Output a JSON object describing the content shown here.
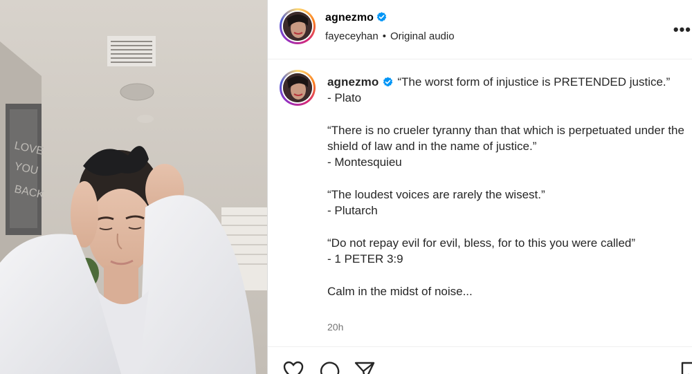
{
  "post": {
    "username": "agnezmo",
    "audio_user": "fayeceyhan",
    "audio_label": "Original audio",
    "more_label": "•••"
  },
  "media": {
    "wall_sign_text": [
      "LOVE",
      "YOU",
      "BACK"
    ]
  },
  "caption": {
    "username": "agnezmo",
    "lines": [
      "“The worst form of injustice is PRETENDED justice.”",
      "- Plato",
      "",
      "“There is no crueler tyranny than that which is perpetuated under the shield of law and in the name of justice.”",
      "- Montesquieu",
      "",
      "“The loudest voices are rarely the wisest.”",
      "- Plutarch",
      "",
      "“Do not repay evil for evil, bless, for to this you were called”",
      "- 1 PETER 3:9",
      "",
      "Calm in the midst of noise..."
    ],
    "time": "20h"
  },
  "actions": {
    "icons": [
      "heart-icon",
      "comment-icon",
      "share-icon",
      "save-icon"
    ]
  },
  "colors": {
    "verified_blue": "#0095f6",
    "muted_text": "#737373"
  }
}
